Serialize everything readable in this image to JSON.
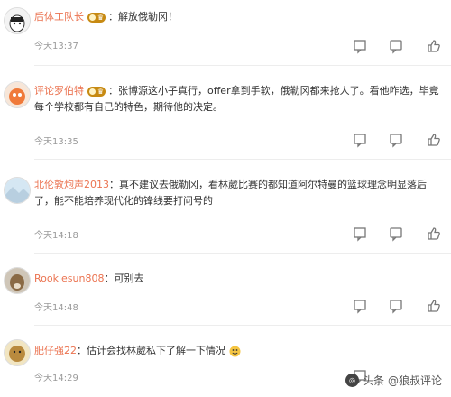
{
  "comments": [
    {
      "user": "后体工队长",
      "text": "解放俄勒冈！",
      "time": "今天13:37"
    },
    {
      "user": "评论罗伯特",
      "text": "张博源这小子真行，offer拿到手软，俄勒冈都来抢人了。看他咋选，毕竟每个学校都有自己的特色，期待他的决定。",
      "time": "今天13:35"
    },
    {
      "user": "北伦敦炮声2013",
      "text": "真不建议去俄勒冈，看林葳比赛的都知道阿尔特曼的篮球理念明显落后了，能不能培养现代化的锋线要打问号的",
      "time": "今天14:18"
    },
    {
      "user": "Rookiesun808",
      "text": "可别去",
      "time": "今天14:48"
    },
    {
      "user": "肥仔强22",
      "text": "估计会找林葳私下了解一下情况",
      "time": "今天14:29"
    }
  ],
  "icons": [
    "share-icon",
    "comment-icon",
    "like-icon"
  ],
  "watermark": {
    "prefix": "头条",
    "author": "@狼叔评论"
  },
  "colors": {
    "username": "#eb7350",
    "time": "#9a9a9a",
    "vip": "#c78a12"
  }
}
